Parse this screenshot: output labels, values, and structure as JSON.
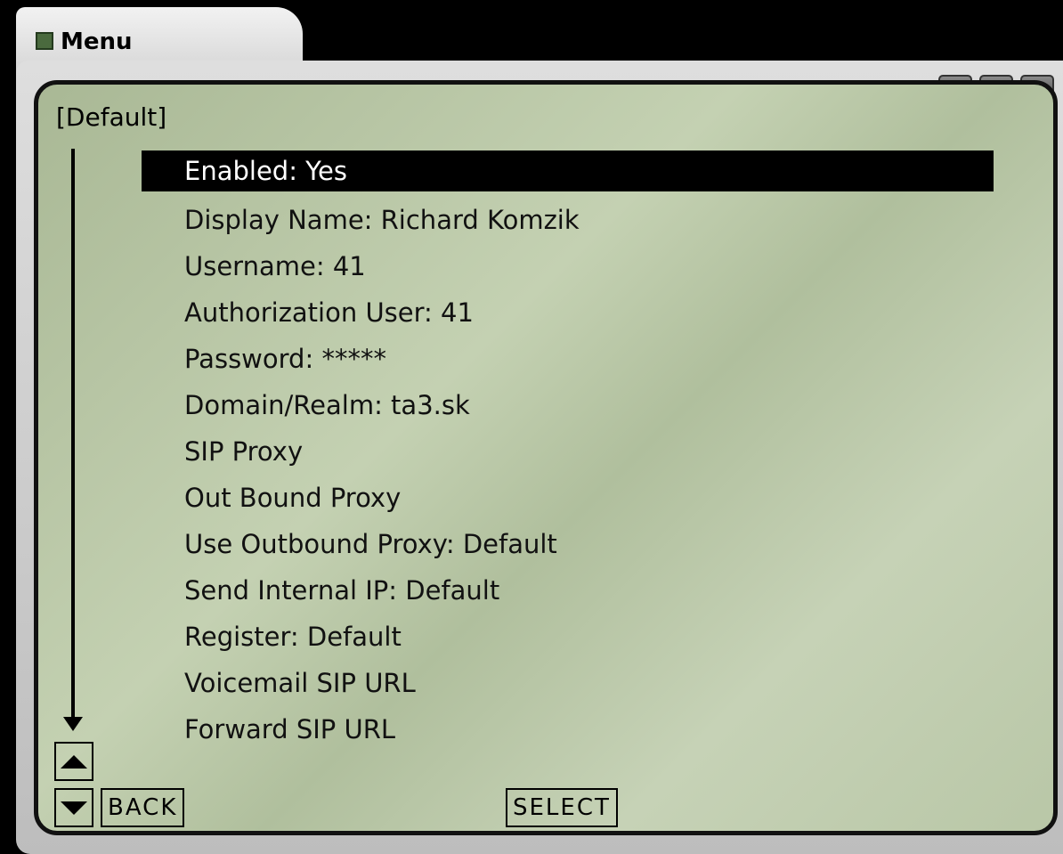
{
  "window": {
    "title": "Menu",
    "buttons": {
      "help": "?",
      "minimize": "_",
      "close": "X"
    }
  },
  "profile": "[Default]",
  "menu": {
    "items": [
      "Enabled: Yes",
      "Display Name: Richard Komzik",
      "Username: 41",
      "Authorization User: 41",
      "Password: *****",
      "Domain/Realm: ta3.sk",
      "SIP Proxy",
      "Out Bound Proxy",
      "Use Outbound Proxy: Default",
      "Send Internal IP: Default",
      "Register: Default",
      "Voicemail SIP URL",
      "Forward SIP URL"
    ]
  },
  "softkeys": {
    "back": "BACK",
    "select": "SELECT"
  },
  "icons": {
    "window": "app-icon",
    "scroll_up": "triangle-up-icon",
    "scroll_down": "triangle-down-icon"
  },
  "colors": {
    "lcd": "#b9c7a7",
    "selection": "#000000"
  }
}
